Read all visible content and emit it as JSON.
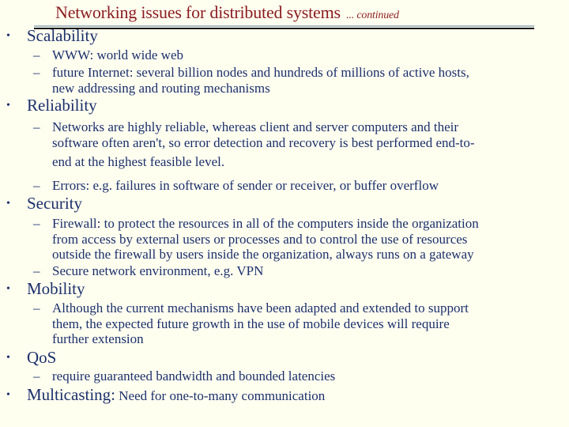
{
  "slide": {
    "title": "Networking issues for distributed systems",
    "title_suffix": "... continued",
    "bullet_glyph": "•",
    "dash_glyph": "–",
    "colors": {
      "background": "#fffff0",
      "title": "#8b1b1f",
      "body": "#1b2f6b",
      "rule_light": "#a9bcc4",
      "rule_dark": "#111111"
    },
    "sections": [
      {
        "heading": "Scalability",
        "items": [
          {
            "lines": [
              "WWW: world wide web"
            ]
          },
          {
            "lines": [
              "future Internet: several billion nodes and hundreds of millions of active hosts,",
              "new addressing and routing mechanisms"
            ]
          }
        ]
      },
      {
        "heading": "Reliability",
        "items": [
          {
            "lines": [
              "Networks are highly reliable, whereas client and server computers and their",
              "software often aren't, so error detection and recovery is best performed end-to-",
              "end at the highest feasible level."
            ]
          },
          {
            "lines": [
              "Errors: e.g. failures in software of sender or receiver, or buffer overflow"
            ]
          }
        ]
      },
      {
        "heading": "Security",
        "items": [
          {
            "lines": [
              "Firewall: to protect the resources in all of the computers inside the organization",
              "from access by external users or processes and to control the use of resources",
              "outside the firewall by users inside the organization, always runs on a gateway"
            ]
          },
          {
            "lines": [
              "Secure network environment, e.g. VPN"
            ]
          }
        ]
      },
      {
        "heading": "Mobility",
        "items": [
          {
            "lines": [
              "Although the current mechanisms have been adapted and extended to support",
              "them, the expected future growth in the use of mobile devices will require",
              "further extension"
            ]
          }
        ]
      },
      {
        "heading": "QoS",
        "items": [
          {
            "lines": [
              "require guaranteed bandwidth and bounded latencies"
            ]
          }
        ]
      },
      {
        "heading": "Multicasting:",
        "heading_suffix": " Need for one-to-many communication",
        "items": []
      }
    ]
  }
}
